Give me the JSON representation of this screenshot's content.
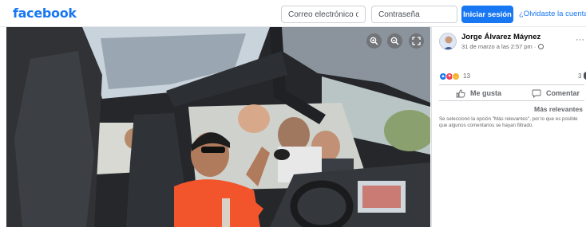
{
  "brand": {
    "logo_text": "facebook",
    "color": "#1877f2"
  },
  "login": {
    "email_placeholder": "Correo electrónico o teléfono",
    "password_placeholder": "Contraseña",
    "submit_label": "Iniciar sesión",
    "forgot_link": "¿Olvidaste la cuenta?"
  },
  "viewer": {
    "controls": [
      "zoom-in-icon",
      "zoom-out-icon",
      "expand-icon"
    ]
  },
  "post": {
    "author": "Jorge Álvarez Máynez",
    "timestamp": "31 de marzo a las 2:57 pm ·",
    "more_label": "···",
    "reactions": {
      "types": [
        "like",
        "love",
        "haha"
      ],
      "count": "13"
    },
    "comments_count": "3",
    "actions": {
      "like": "Me gusta",
      "comment": "Comentar"
    },
    "sort_label": "Más relevantes",
    "sort_notice": "Se seleccionó la opción \"Más relevantes\", por lo que es posible que algunos comentarios se hayan filtrado."
  }
}
